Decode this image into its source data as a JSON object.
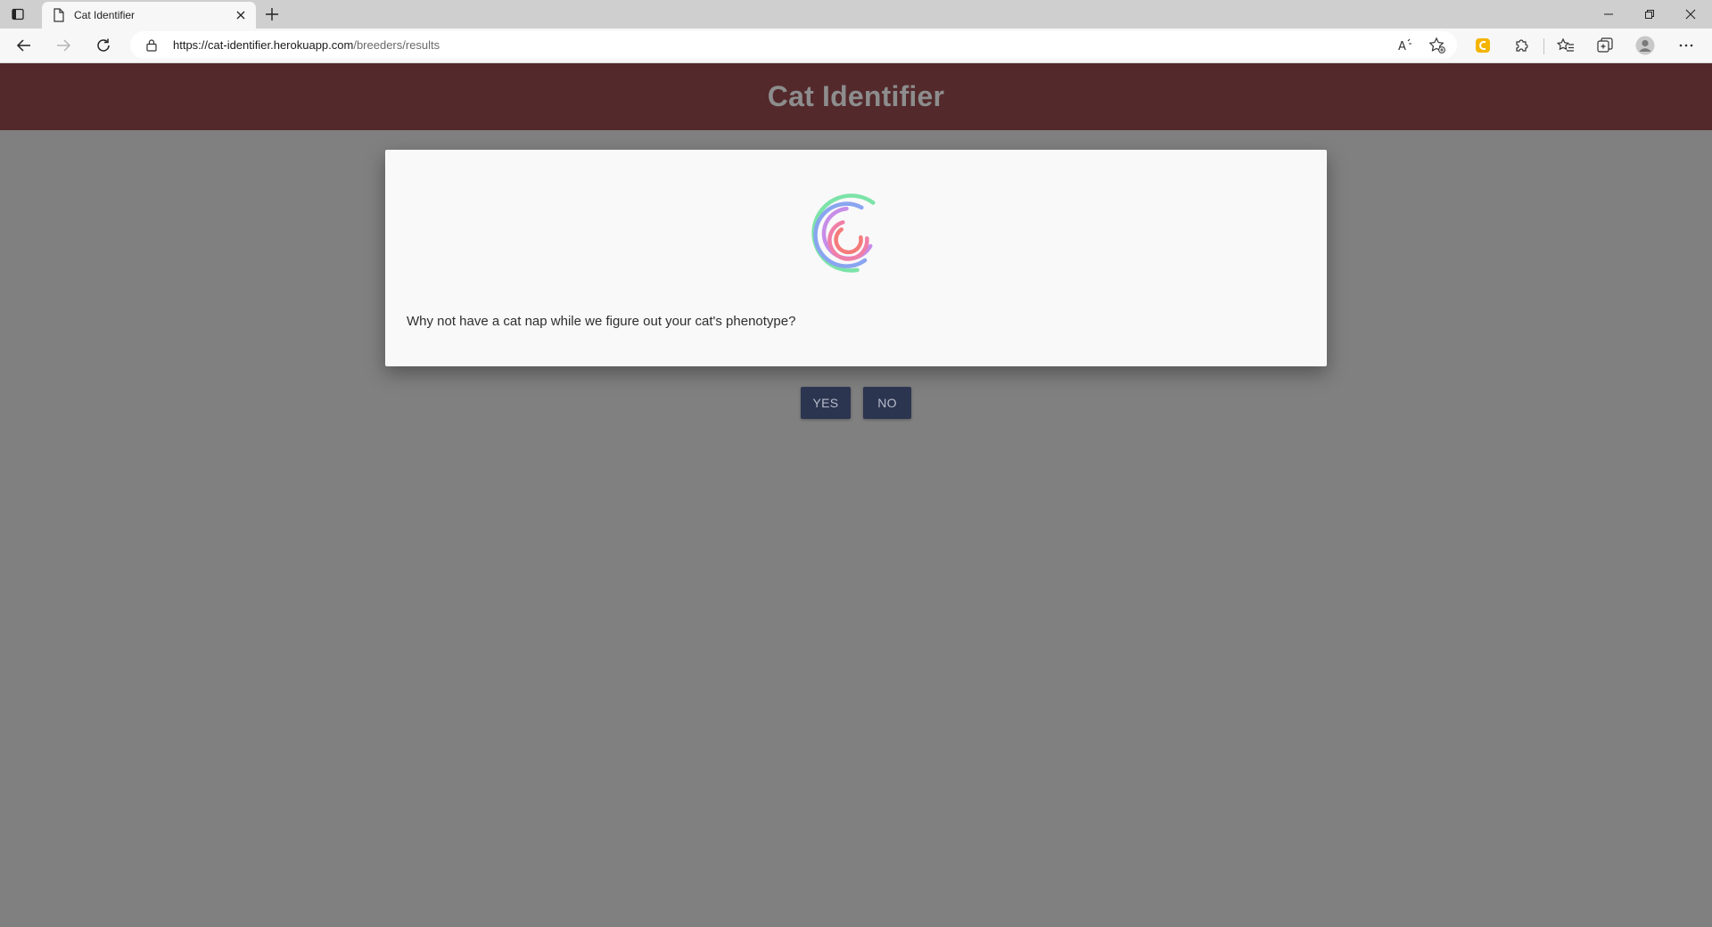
{
  "browser": {
    "tab_title": "Cat Identifier",
    "url_host": "https://cat-identifier.herokuapp.com",
    "url_path": "/breeders/results"
  },
  "page": {
    "site_title": "Cat Identifier",
    "dialog_message": "Why not have a cat nap while we figure out your cat's phenotype?",
    "yes_label": "YES",
    "no_label": "NO"
  },
  "colors": {
    "header_bg": "#53292c",
    "button_bg": "#2c3550",
    "overlay": "#808080"
  },
  "icons": {
    "spinner": "rainbow-arc-spinner"
  }
}
